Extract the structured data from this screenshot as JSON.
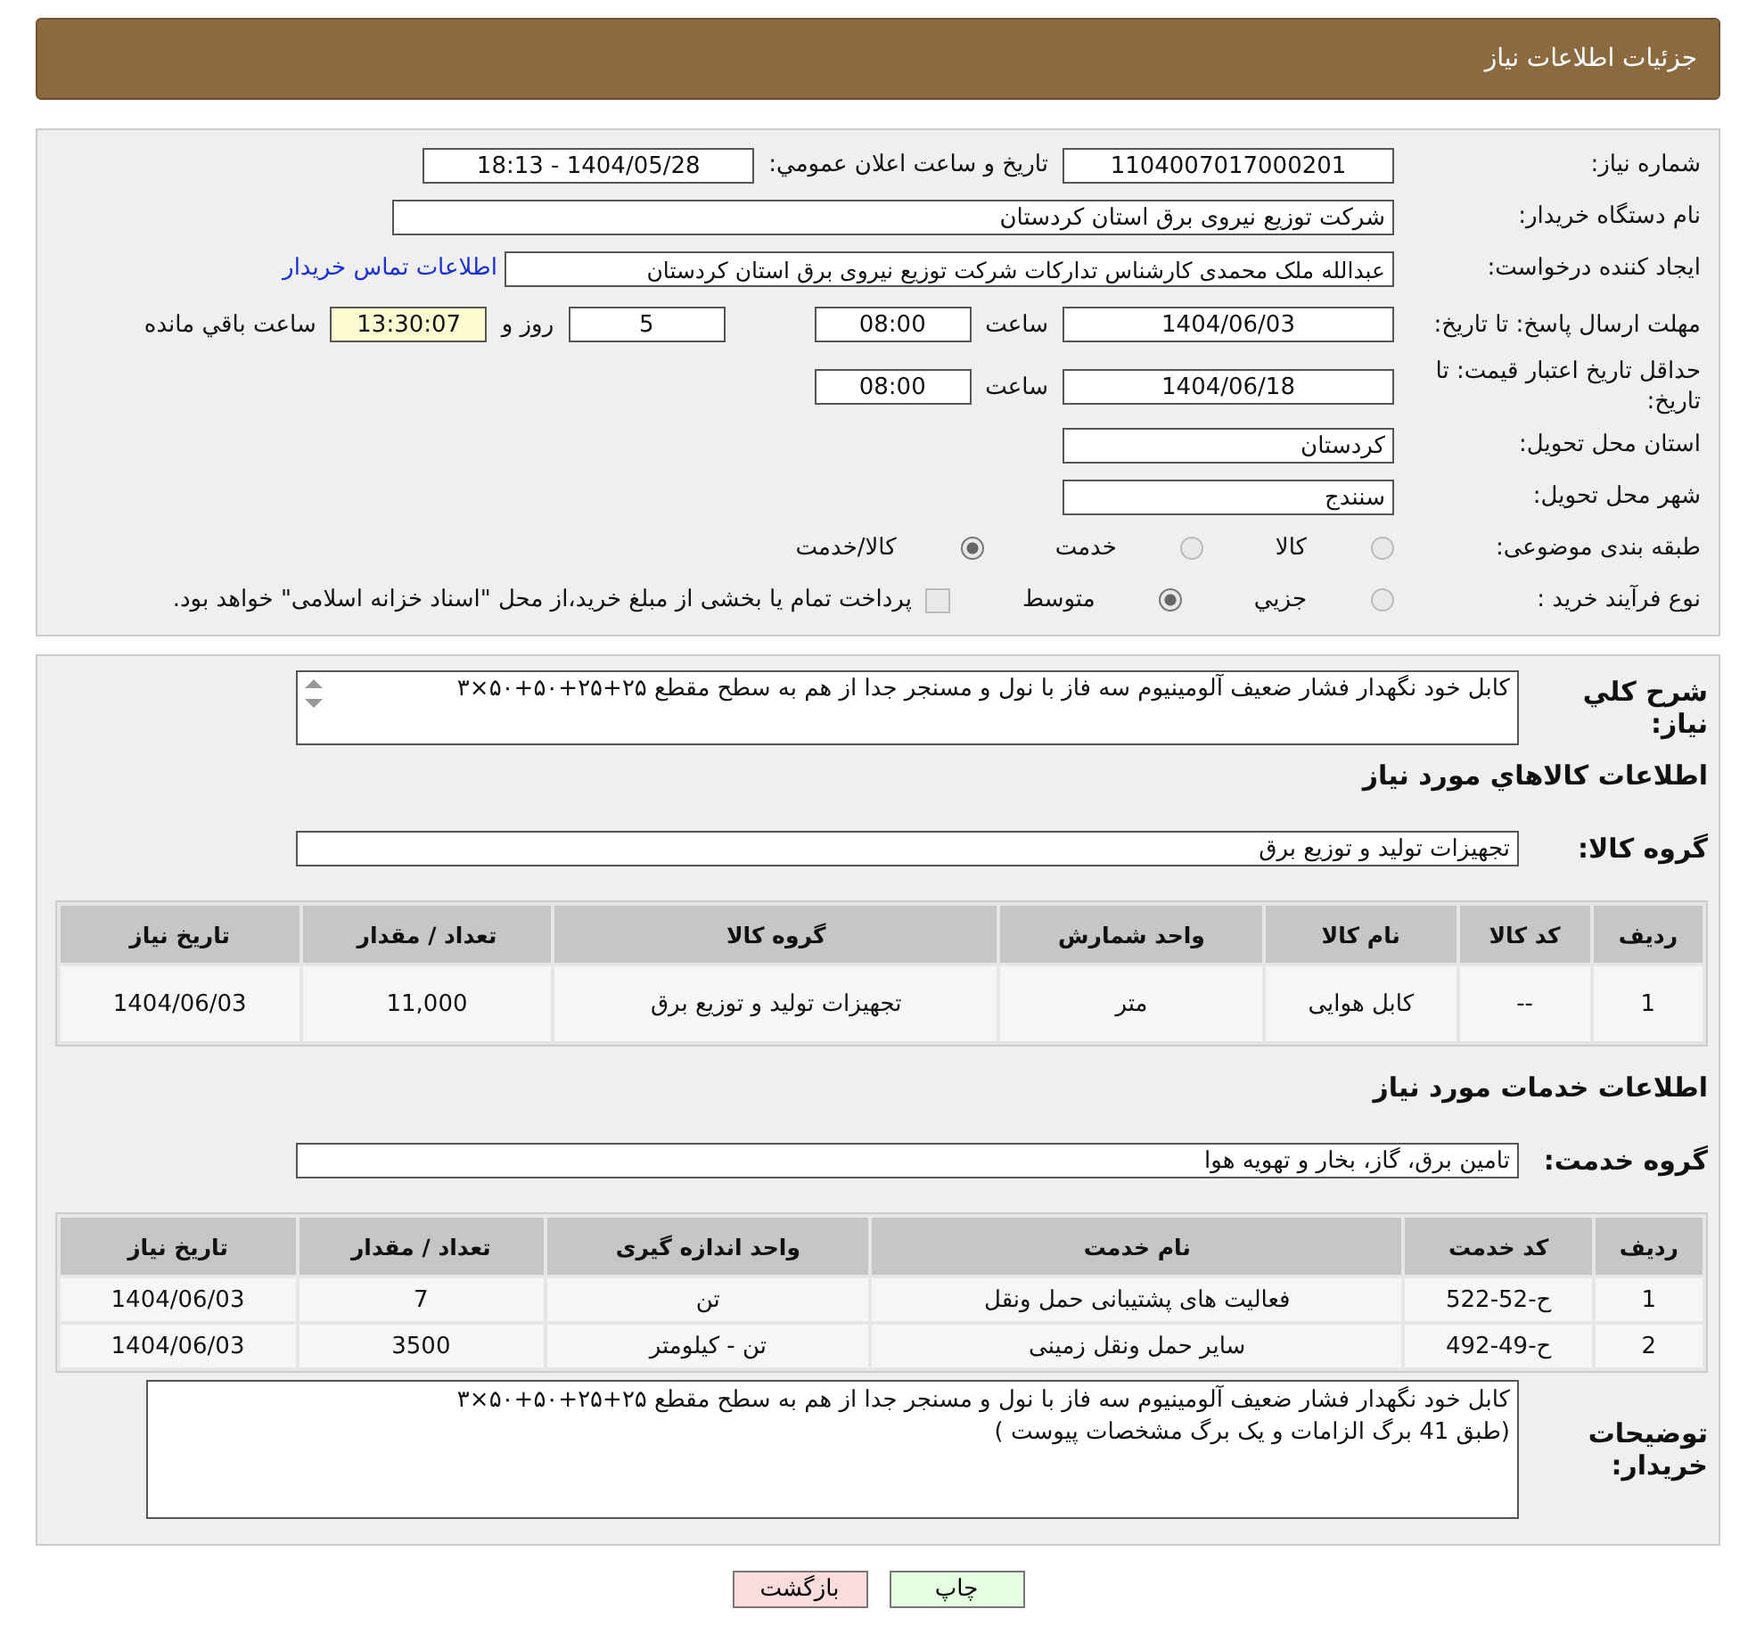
{
  "header": {
    "title": "جزئیات اطلاعات نیاز"
  },
  "need_number": {
    "label": "شماره نیاز:",
    "value": "1104007017000201"
  },
  "announce": {
    "label": "تاريخ و ساعت اعلان عمومي:",
    "value": "1404/05/28 - 18:13"
  },
  "buyer": {
    "label": "نام دستگاه خریدار:",
    "value": "شرکت توزیع نیروی برق استان کردستان"
  },
  "creator": {
    "label": "ایجاد کننده درخواست:",
    "value": "عبدالله ملک محمدی کارشناس تدارکات شرکت توزیع نیروی برق استان کردستان",
    "link": "اطلاعات تماس خریدار"
  },
  "reply_deadline": {
    "label": "مهلت ارسال پاسخ: تا تاریخ:",
    "date": "1404/06/03",
    "time_label": "ساعت",
    "time": "08:00",
    "days": "5",
    "days_label": "روز و",
    "remaining": "13:30:07",
    "remaining_label": "ساعت باقي مانده"
  },
  "price_validity": {
    "label": "حداقل تاریخ اعتبار قیمت: تا تاریخ:",
    "date": "1404/06/18",
    "time_label": "ساعت",
    "time": "08:00"
  },
  "province": {
    "label": "استان محل تحویل:",
    "value": "کردستان"
  },
  "city": {
    "label": "شهر محل تحویل:",
    "value": "سنندج"
  },
  "category": {
    "label": "طبقه بندی موضوعی:",
    "options": [
      {
        "label": "کالا",
        "selected": false
      },
      {
        "label": "خدمت",
        "selected": false
      },
      {
        "label": "کالا/خدمت",
        "selected": true
      }
    ]
  },
  "process": {
    "label": "نوع فرآیند خرید :",
    "options": [
      {
        "label": "جزيي",
        "selected": false
      },
      {
        "label": "متوسط",
        "selected": true
      }
    ],
    "payment": {
      "checked": false,
      "text": "پرداخت تمام یا بخشی از مبلغ خرید،از محل \"اسناد خزانه اسلامی\" خواهد بود."
    }
  },
  "summary": {
    "label": "شرح کلي نياز:",
    "value": "کابل خود نگهدار فشار ضعیف آلومینیوم سه فاز با نول و مسنجر جدا از هم به سطح مقطع ۲۵+۲۵+۵۰+۵۰×۳"
  },
  "goods": {
    "title": "اطلاعات کالاهاي مورد نياز",
    "group_label": "گروه کالا:",
    "group": "تجهیزات تولید و توزیع برق",
    "columns": [
      "ردیف",
      "کد کالا",
      "نام کالا",
      "واحد شمارش",
      "گروه کالا",
      "تعداد / مقدار",
      "تاریخ نیاز"
    ],
    "rows": [
      [
        "1",
        "--",
        "کابل هوایی",
        "متر",
        "تجهیزات تولید و توزیع برق",
        "11,000",
        "1404/06/03"
      ]
    ]
  },
  "services": {
    "title": "اطلاعات خدمات مورد نیاز",
    "group_label": "گروه خدمت:",
    "group": "تامین برق، گاز، بخار و تهویه هوا",
    "columns": [
      "ردیف",
      "کد خدمت",
      "نام خدمت",
      "واحد اندازه گیری",
      "تعداد / مقدار",
      "تاریخ نیاز"
    ],
    "rows": [
      [
        "1",
        "ح-52-522",
        "فعالیت های پشتیبانی حمل ونقل",
        "تن",
        "7",
        "1404/06/03"
      ],
      [
        "2",
        "ح-49-492",
        "سایر حمل ونقل زمینی",
        "تن - کیلومتر",
        "3500",
        "1404/06/03"
      ]
    ]
  },
  "buyer_notes": {
    "label": "توضیحات خریدار:",
    "lines": [
      "کابل خود نگهدار فشار ضعیف آلومینیوم سه فاز با نول و مسنجر جدا از هم به سطح مقطع ۲۵+۲۵+۵۰+۵۰×۳",
      "(طبق 41  برگ الزامات و یک برگ مشخصات پیوست )"
    ]
  },
  "buttons": [
    {
      "kind": "print",
      "label": "چاپ"
    },
    {
      "kind": "back",
      "label": "بازگشت"
    }
  ]
}
